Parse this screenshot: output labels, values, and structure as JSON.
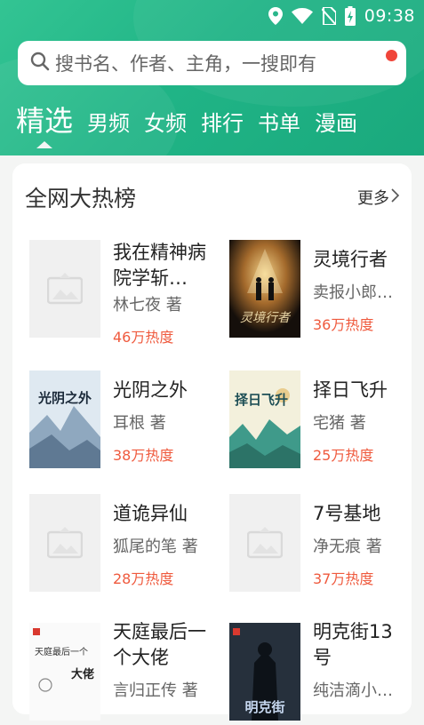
{
  "status_bar": {
    "time": "09:38"
  },
  "search": {
    "placeholder": "搜书名、作者、主角，一搜即有"
  },
  "tabs": [
    {
      "label": "精选",
      "active": true
    },
    {
      "label": "男频"
    },
    {
      "label": "女频"
    },
    {
      "label": "排行"
    },
    {
      "label": "书单"
    },
    {
      "label": "漫画"
    }
  ],
  "section": {
    "title": "全网大热榜",
    "more_label": "更多"
  },
  "books": [
    {
      "title": "我在精神病院学斩…",
      "author": "林七夜 著",
      "heat": "46万热度",
      "cover": "placeholder"
    },
    {
      "title": "灵境行者",
      "author": "卖报小郎…",
      "heat": "36万热度",
      "cover": "dark-stage"
    },
    {
      "title": "光阴之外",
      "author": "耳根 著",
      "heat": "38万热度",
      "cover": "ink-mountain",
      "cover_text": "光阴之外"
    },
    {
      "title": "择日飞升",
      "author": "宅猪 著",
      "heat": "25万热度",
      "cover": "green-mountain",
      "cover_text": "择日飞升"
    },
    {
      "title": "道诡异仙",
      "author": "狐尾的笔 著",
      "heat": "28万热度",
      "cover": "placeholder"
    },
    {
      "title": "7号基地",
      "author": "净无痕 著",
      "heat": "37万热度",
      "cover": "placeholder"
    },
    {
      "title": "天庭最后一个大佬",
      "author": "言归正传 著",
      "heat": "",
      "cover": "white-text",
      "cover_text": "天庭最后一个 大佬"
    },
    {
      "title": "明克街13号",
      "author": "纯洁滴小…",
      "heat": "",
      "cover": "dark-figure"
    }
  ],
  "colors": {
    "accent": "#20b486",
    "heat": "#ef5a3e",
    "badge": "#f0453a"
  }
}
